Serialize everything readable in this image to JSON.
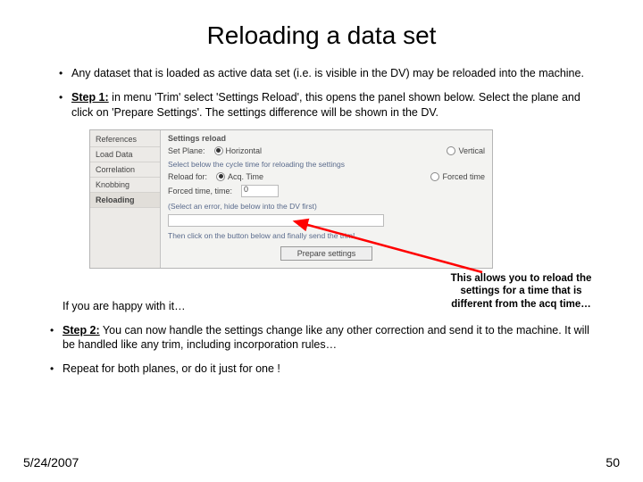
{
  "title": "Reloading a data set",
  "bullets": {
    "b1": "Any dataset that is loaded as active data set (i.e. is visible in the DV) may be reloaded into the machine.",
    "step1_label": "Step 1:",
    "step1_text": " in menu 'Trim' select 'Settings Reload', this opens the panel shown below. Select the plane and click on 'Prepare Settings'. The settings difference will be shown in the DV."
  },
  "panel": {
    "sidebar": {
      "items": [
        "References",
        "Load Data",
        "Correlation",
        "Knobbing",
        "Reloading"
      ]
    },
    "section_title": "Settings reload",
    "plane_label": "Set Plane:",
    "plane_opts": {
      "horizontal": "Horizontal",
      "vertical": "Vertical"
    },
    "hint1": "Select below the cycle time for reloading the settings",
    "reload_label": "Reload for:",
    "reload_opts": {
      "acq": "Acq. Time",
      "forced": "Forced time"
    },
    "forced_label": "Forced time, time:",
    "forced_time_value": "0",
    "hint2": "(Select an error, hide below into the DV first)",
    "hint3": "Then click on the button below and finally send the trim!",
    "prepare_button": "Prepare settings"
  },
  "callout": "This allows you to reload the settings for a time that is different from the acq time…",
  "lower": {
    "happy": "If you are happy with it…",
    "step2_label": "Step 2:",
    "step2_text": " You can now handle the settings change like any other correction and send it to the machine. It will be handled like any trim, including incorporation rules…",
    "repeat": "Repeat for both planes, or do it just for one !"
  },
  "footer": {
    "date": "5/24/2007",
    "page": "50"
  }
}
